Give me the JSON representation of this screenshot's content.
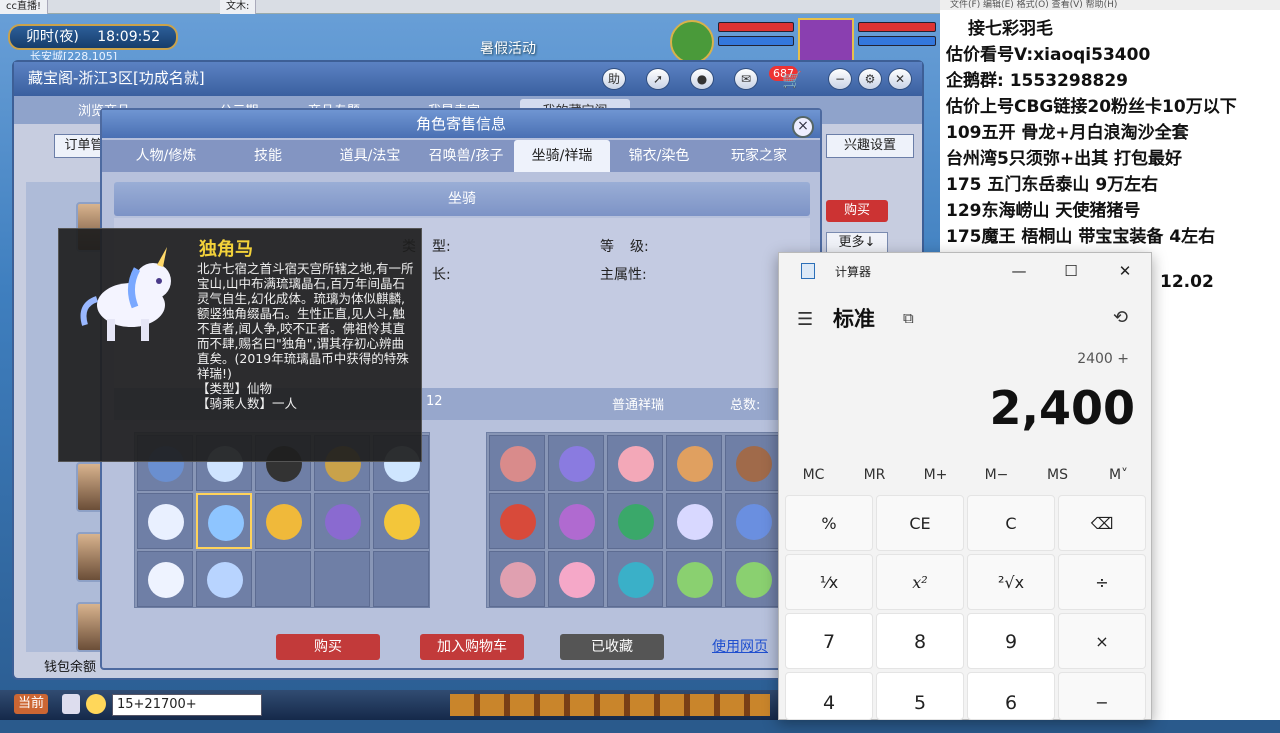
{
  "browser_tabs": [
    "cc直播!",
    "文木:"
  ],
  "game": {
    "clock_period": "卯时(夜)",
    "clock_time": "18:09:52",
    "location": "长安城[228,105]",
    "event_banner": "暑假活动"
  },
  "cbg": {
    "title": "藏宝阁-浙江3区[功成名就]",
    "toolbar": {
      "help": "助",
      "badge": "687"
    },
    "nav_tabs": [
      "浏览商品",
      "公示期",
      "商品专题",
      "我是卖家",
      "我的藏宝阁"
    ],
    "order_btn": "订单管",
    "interest_btn": "兴趣设置",
    "buy_side": "购买",
    "more_side": "更多↓",
    "wallet": "钱包余额"
  },
  "dialog": {
    "title": "角色寄售信息",
    "close": "×",
    "tabs": [
      "人物/修炼",
      "技能",
      "道具/法宝",
      "召唤兽/孩子",
      "坐骑/祥瑞",
      "锦衣/染色",
      "玩家之家"
    ],
    "active_tab": 4,
    "section_title": "坐骑",
    "fields": [
      {
        "label": "类",
        "value": "型:"
      },
      {
        "label": "等",
        "value": "级:"
      },
      {
        "label": "长:",
        "value": ""
      },
      {
        "label": "主属性:",
        "value": ""
      }
    ],
    "left_header_count": "12",
    "right_header_title": "普通祥瑞",
    "right_header_total": "总数:",
    "buttons": {
      "buy": "购买",
      "add_cart": "加入购物车",
      "favorited": "已收藏",
      "web": "使用网页"
    }
  },
  "tooltip": {
    "name": "独角马",
    "description": "北方七宿之首斗宿天宫所辖之地,有一所宝山,山中布满琉璃晶石,百万年间晶石灵气自生,幻化成体。琉璃为体似麒麟,额竖独角缀晶石。生性正直,见人斗,触不直者,闻人争,咬不正者。佛祖怜其直而不肆,赐名曰\"独角\",谓其存初心辨曲直矣。(2019年琉璃晶币中获得的特殊祥瑞!)",
    "type_line": "【类型】仙物",
    "riders_line": "【骑乘人数】一人"
  },
  "chat": {
    "current": "当前",
    "input": "15+21700+"
  },
  "notes": [
    "接七彩羽毛",
    "估价看号V:xiaoqi53400",
    "企鹅群: 1553298829",
    "估价上号CBG链接20粉丝卡10万以下",
    "109五开 骨龙+月白浪淘沙全套",
    "台州湾5只须弥+出其 打包最好",
    "175 五门东岳泰山  9万左右",
    "129东海崂山 天使猪猪号",
    "175魔王 梧桐山  带宝宝装备 4左右",
    "12.02"
  ],
  "right_menu": "文件(F)   编辑(E)   格式(O)   查看(V)   帮助(H)",
  "calculator": {
    "window_title": "计算器",
    "mode": "标准",
    "expression": "2400 +",
    "display": "2,400",
    "memory": [
      "MC",
      "MR",
      "M+",
      "M−",
      "MS",
      "M˅"
    ],
    "keys": [
      "%",
      "CE",
      "C",
      "⌫",
      "¹⁄x",
      "x²",
      "²√x",
      "÷",
      "7",
      "8",
      "9",
      "×",
      "4",
      "5",
      "6",
      "−"
    ]
  },
  "colors": {
    "accent_red": "#c33333",
    "tooltip_gold": "#f3d23a",
    "link_blue": "#1f4fcf"
  }
}
